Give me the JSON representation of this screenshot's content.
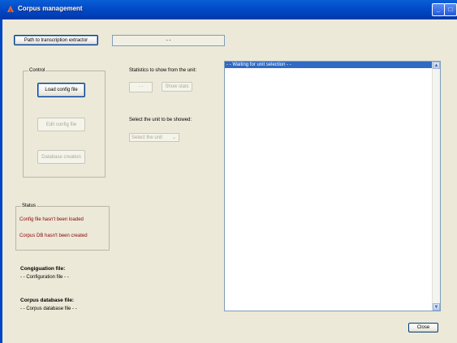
{
  "window": {
    "title": "Corpus management"
  },
  "path_button": {
    "label": "Path to transcription extractor"
  },
  "path_field": {
    "value": "- -"
  },
  "control": {
    "legend": "Control",
    "load_config": "Load config file",
    "edit_config": "Edit config file",
    "database_creation": "Database creation"
  },
  "statistics": {
    "label": "Statistics to show from the unit:",
    "value_field": "- -",
    "show_stats": "Show stats"
  },
  "unit_select": {
    "label": "Select the unit to be showed:",
    "selected": "Select the unit"
  },
  "status": {
    "legend": "Status",
    "config_status": "Config file hasn't been loaded",
    "db_status": "Corpus DB hasn't been created"
  },
  "config_file": {
    "heading": "Congiguation file:",
    "value": "- - Configuration file - -"
  },
  "database_file": {
    "heading": "Corpus database file:",
    "value": "- - Corpus database file  - -"
  },
  "listbox": {
    "selected_item": "- - Waiting for unit selection - -"
  },
  "close_button": {
    "label": "Close"
  },
  "colors": {
    "title_bar": "#0046c5",
    "window_bg": "#ece9d8",
    "selection": "#316ac5",
    "status_text": "#8b0000"
  },
  "icons": [
    "app-icon",
    "minimize-icon",
    "maximize-icon",
    "close-icon",
    "scroll-up-icon",
    "scroll-down-icon",
    "dropdown-arrow-icon"
  ]
}
